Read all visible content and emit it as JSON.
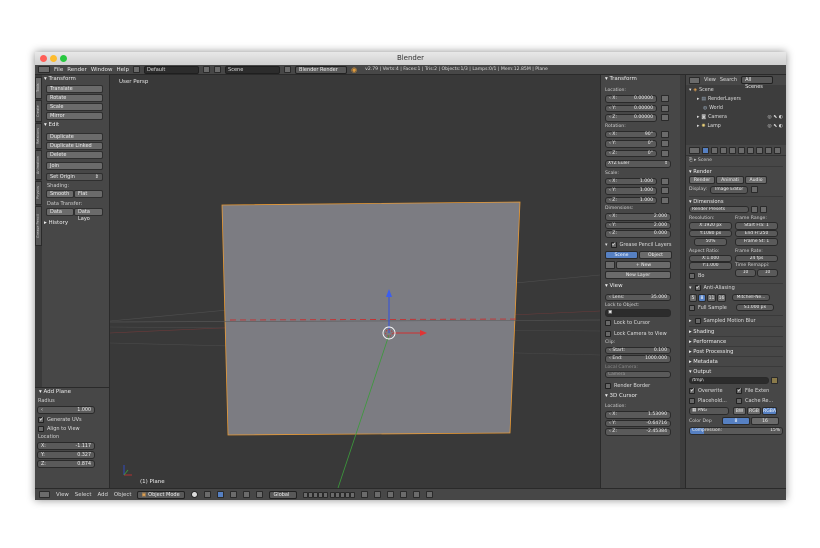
{
  "window": {
    "title": "Blender"
  },
  "menubar": {
    "items": [
      "File",
      "Render",
      "Window",
      "Help"
    ],
    "layout": "Default",
    "scene": "Scene",
    "engine": "Blender Render",
    "stats": "v2.79 | Verts:4 | Faces:1 | Tris:2 | Objects:1/3 | Lamps:0/1 | Mem:12.85M | Plane"
  },
  "toolshelf": {
    "tabs": [
      "Tools",
      "Create",
      "Relations",
      "Animation",
      "Physics",
      "Grease Pencil"
    ],
    "transform": {
      "title": "Transform",
      "buttons": [
        "Translate",
        "Rotate",
        "Scale",
        "Mirror"
      ]
    },
    "edit": {
      "title": "Edit",
      "buttons": [
        "Duplicate",
        "Duplicate Linked",
        "Delete",
        "Join"
      ],
      "set_origin": "Set Origin"
    },
    "shading": {
      "title": "Shading:",
      "smooth": "Smooth",
      "flat": "Flat"
    },
    "data_transfer": {
      "title": "Data Transfer:",
      "data": "Data",
      "data_layout": "Data Layo"
    },
    "history": "History"
  },
  "operator": {
    "title": "Add Plane",
    "radius_label": "Radius",
    "radius": "1.000",
    "generate_uvs": "Generate UVs",
    "align_to_view": "Align to View",
    "location_label": "Location",
    "x": "-1.117",
    "y": "0.327",
    "z": "0.874"
  },
  "viewport": {
    "label": "User Persp",
    "object_label": "(1) Plane"
  },
  "npanel": {
    "transform_title": "Transform",
    "location_label": "Location:",
    "location": {
      "x": "0.00000",
      "y": "0.00000",
      "z": "0.00000"
    },
    "rotation_label": "Rotation:",
    "rotation": {
      "x": "90°",
      "y": "0°",
      "z": "0°"
    },
    "rotation_mode": "XYZ Euler",
    "scale_label": "Scale:",
    "scale": {
      "x": "1.000",
      "y": "1.000",
      "z": "1.000"
    },
    "dimensions_label": "Dimensions:",
    "dimensions": {
      "x": "2.000",
      "y": "2.000",
      "z": "0.000"
    },
    "gp_layers": "Grease Pencil Layers",
    "scene_btn": "Scene",
    "object_btn": "Object",
    "new_btn": "New",
    "new_layer_btn": "New Layer",
    "view_title": "View",
    "lens_label": "Lens:",
    "lens": "35.000",
    "lock_to_object": "Lock to Object:",
    "lock_to_cursor": "Lock to Cursor",
    "lock_camera": "Lock Camera to View",
    "clip_label": "Clip:",
    "clip_start_label": "Start:",
    "clip_start": "0.100",
    "clip_end_label": "End:",
    "clip_end": "1000.000",
    "local_camera": "Local Camera:",
    "camera": "Camera",
    "render_border": "Render Border",
    "cursor_title": "3D Cursor",
    "cursor_location_label": "Location:",
    "cursor": {
      "x": "1.53090",
      "y": "-0.64716",
      "z": "-2.45384"
    }
  },
  "outliner": {
    "view": "View",
    "search": "Search",
    "filter": "All Scenes",
    "items": [
      "Scene",
      "RenderLayers",
      "World",
      "Camera",
      "Lamp"
    ]
  },
  "props": {
    "scene_label": "Scene",
    "render_title": "Render",
    "render_btn": "Render",
    "animation_btn": "Animati",
    "audio_btn": "Audio",
    "display_label": "Display:",
    "display": "Image Editor",
    "dimensions_title": "Dimensions",
    "render_presets": "Render Presets",
    "resolution_label": "Resolution:",
    "res_x": "X:1920 px",
    "res_y": "Y:1080 px",
    "res_pct": "50%",
    "frame_range_label": "Frame Range:",
    "start_frame": "Start Fra: 1",
    "end_frame": "End Fr:250",
    "frame_step": "Frame St: 1",
    "aspect_label": "Aspect Ratio:",
    "aspect_x": "X:1.000",
    "aspect_y": "Y:1.000",
    "frame_rate_label": "Frame Rate:",
    "fps": "24 fps",
    "time_remap_label": "Time Remappi:",
    "remap_old": "10",
    "remap_new": "10",
    "bo_label": "Bo",
    "anti_alias_title": "Anti-Aliasing",
    "aa_levels": [
      "5",
      "8",
      "11",
      "16"
    ],
    "aa_filter": "Mitchell-Ne...",
    "full_sample": "Full Sample",
    "filter_size": "S1.000 px",
    "sampled_motion_blur": "Sampled Motion Blur",
    "shading_title": "Shading",
    "performance_title": "Performance",
    "post_processing_title": "Post Processing",
    "metadata_title": "Metadata",
    "output_title": "Output",
    "output_path": "/tmp\\",
    "overwrite": "Overwrite",
    "file_extensions": "File Exten",
    "placeholders": "Placehold...",
    "cache_result": "Cache Re...",
    "format": "PNG",
    "color_modes": [
      "BW",
      "RGB",
      "RGBA"
    ],
    "color_depth_label": "Color Dep",
    "depth_8": "8",
    "depth_16": "16",
    "compression_label": "Compression:",
    "compression": "15%"
  },
  "footer": {
    "items": [
      "View",
      "Select",
      "Add",
      "Object"
    ],
    "mode": "Object Mode",
    "orientation": "Global"
  }
}
